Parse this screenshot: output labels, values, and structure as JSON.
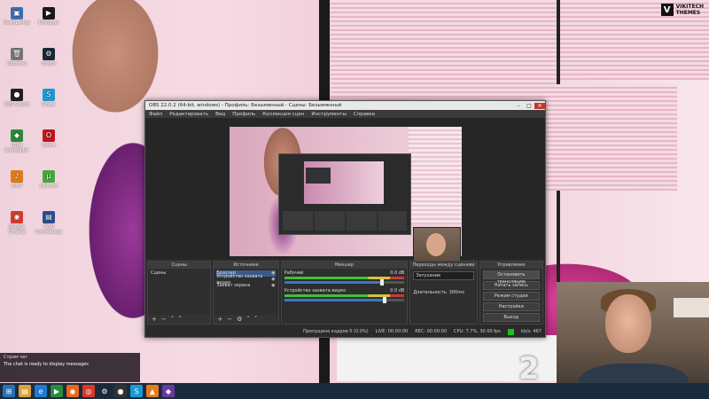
{
  "watermark": {
    "mark": "V",
    "line1": "VIKITECH",
    "line2": "THEMES"
  },
  "desktop_icons": [
    {
      "name": "icon-1",
      "label": "Компьютер",
      "glyph": "▣",
      "color": "#3a6fb0"
    },
    {
      "name": "icon-2",
      "label": "Корзина",
      "glyph": "🗑",
      "color": "#777"
    },
    {
      "name": "icon-3",
      "label": "OBS Studio",
      "glyph": "●",
      "color": "#222"
    },
    {
      "name": "icon-4",
      "label": "IObit Uninstaller",
      "glyph": "◆",
      "color": "#2a8a3a"
    },
    {
      "name": "icon-5",
      "label": "AIMP",
      "glyph": "♪",
      "color": "#e07a1a"
    },
    {
      "name": "icon-6",
      "label": "Google Chrome",
      "glyph": "◉",
      "color": "#d83a2a"
    },
    {
      "name": "icon-7",
      "label": "KMPlayer",
      "glyph": "▶",
      "color": "#1a1a1a"
    },
    {
      "name": "icon-8",
      "label": "Steam",
      "glyph": "⚙",
      "color": "#1b2838"
    },
    {
      "name": "icon-9",
      "label": "Skype",
      "glyph": "S",
      "color": "#1a9ad6"
    },
    {
      "name": "icon-10",
      "label": "Opera",
      "glyph": "O",
      "color": "#c4141b"
    },
    {
      "name": "icon-11",
      "label": "uTorrent",
      "glyph": "µ",
      "color": "#46a83a"
    },
    {
      "name": "icon-12",
      "label": "Total Commander",
      "glyph": "▤",
      "color": "#2d4f8f"
    }
  ],
  "obs": {
    "title": "OBS 22.0.2 (64-bit, windows) - Профиль: Безымянный - Сцены: Безымянный",
    "menu": [
      "Файл",
      "Редактировать",
      "Вид",
      "Профиль",
      "Коллекция сцен",
      "Инструменты",
      "Справка"
    ],
    "docks": {
      "scenes": {
        "title": "Сцены",
        "items": [
          "Сцены"
        ]
      },
      "sources": {
        "title": "Источники",
        "items": [
          "Браузер",
          "Устройство захвата видео",
          "Захват экрана"
        ]
      },
      "mixer": {
        "title": "Микшер",
        "channels": [
          {
            "name": "Рабочий",
            "level": "0.0 dB"
          },
          {
            "name": "Устройство захвата видео",
            "level": "0.0 dB"
          }
        ]
      },
      "transitions": {
        "title": "Переходы между сценами",
        "type": "Затухание",
        "duration_label": "Длительность",
        "duration": "300ms"
      },
      "controls": {
        "title": "Управление",
        "buttons": [
          "Остановить трансляцию",
          "Начать запись",
          "Режим студии",
          "Настройки",
          "Выход"
        ]
      }
    },
    "status": {
      "dropped": "Пропущено кадров 0 (0.0%)",
      "live": "LIVE: 00:00:00",
      "rec": "REC: 00:00:00",
      "cpu": "CPU: 7.7%, 30.00 fps",
      "kbps": "kb/s: 467"
    }
  },
  "chat": {
    "header": "Стрим чат",
    "message": "The chat is ready to display messages"
  },
  "taskbar": {
    "items": [
      {
        "name": "start-icon",
        "glyph": "⊞",
        "color": "#2d6fb3"
      },
      {
        "name": "explorer-icon",
        "glyph": "▤",
        "color": "#d8a23a"
      },
      {
        "name": "ie-icon",
        "glyph": "e",
        "color": "#1f7ad0"
      },
      {
        "name": "media-icon",
        "glyph": "▶",
        "color": "#2b8a3e"
      },
      {
        "name": "firefox-icon",
        "glyph": "◉",
        "color": "#e66a1a"
      },
      {
        "name": "chrome-icon",
        "glyph": "◎",
        "color": "#d83a2a"
      },
      {
        "name": "steam-icon",
        "glyph": "⚙",
        "color": "#1b2838"
      },
      {
        "name": "obs-icon",
        "glyph": "●",
        "color": "#333"
      },
      {
        "name": "skype-icon",
        "glyph": "S",
        "color": "#1a9ad6"
      },
      {
        "name": "vlc-icon",
        "glyph": "▲",
        "color": "#e47c1a"
      },
      {
        "name": "game-icon",
        "glyph": "◆",
        "color": "#6a3aa0"
      }
    ]
  }
}
